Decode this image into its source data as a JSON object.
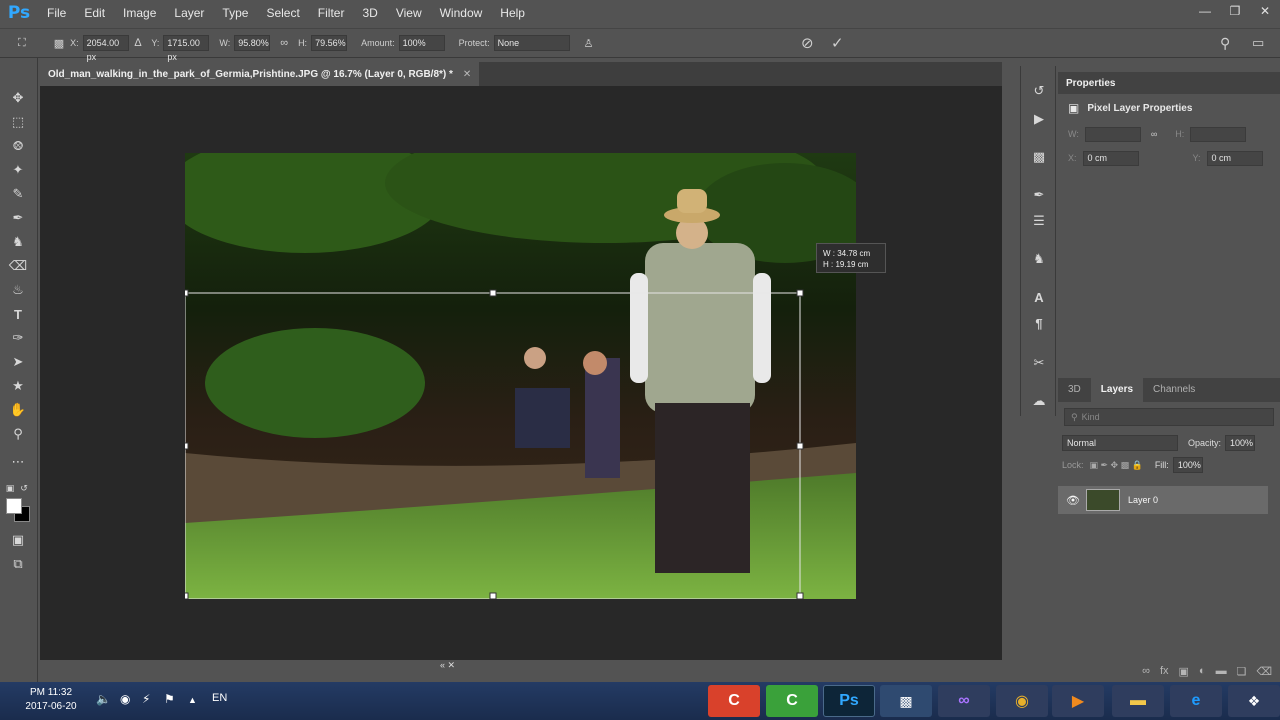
{
  "app": {
    "logo": "Ps"
  },
  "menu": [
    "File",
    "Edit",
    "Image",
    "Layer",
    "Type",
    "Select",
    "Filter",
    "3D",
    "View",
    "Window",
    "Help"
  ],
  "options": {
    "x_label": "X:",
    "x_value": "2054.00 px",
    "y_label": "Y:",
    "y_value": "1715.00 px",
    "w_label": "W:",
    "w_value": "95.80%",
    "h_label": "H:",
    "h_value": "79.56%",
    "amount_label": "Amount:",
    "amount_value": "100%",
    "protect_label": "Protect:",
    "protect_value": "None"
  },
  "document": {
    "tab_title": "Old_man_walking_in_the_park_of_Germia,Prishtine.JPG @ 16.7% (Layer 0, RGB/8*) *",
    "readout_w": "W : 34.78 cm",
    "readout_h": "H : 19.19 cm"
  },
  "properties": {
    "tab": "Properties",
    "header": "Pixel Layer Properties",
    "w_label": "W:",
    "h_label": "H:",
    "x_label": "X:",
    "x_value": "0 cm",
    "y_label": "Y:",
    "y_value": "0 cm"
  },
  "layers": {
    "tabs": [
      "3D",
      "Layers",
      "Channels"
    ],
    "search_placeholder": "Kind",
    "blend_mode": "Normal",
    "opacity_label": "Opacity:",
    "opacity_value": "100%",
    "lock_label": "Lock:",
    "fill_label": "Fill:",
    "fill_value": "100%",
    "layer_name": "Layer 0"
  },
  "taskbar": {
    "time": "PM 11:32",
    "date": "2017-06-20",
    "language": "EN"
  },
  "colors": {
    "foreground": "#ffffff",
    "background": "#000000",
    "accent": "#31a8ff"
  }
}
